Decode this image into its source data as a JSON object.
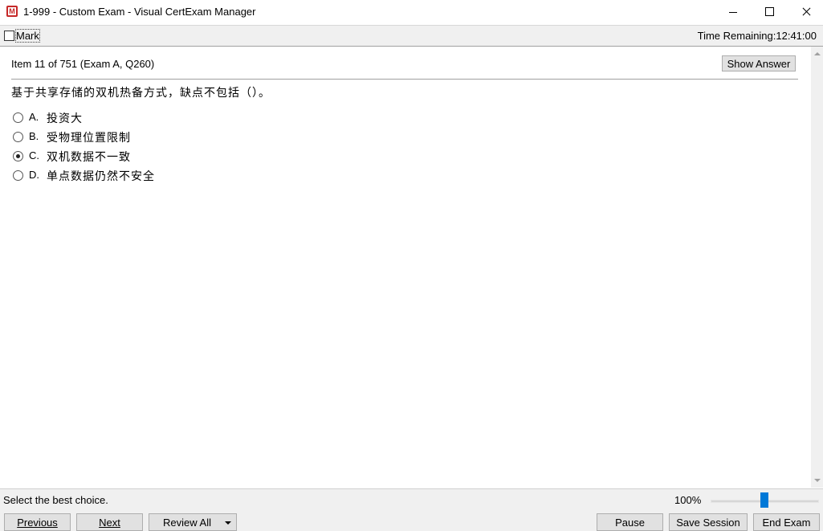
{
  "window": {
    "title": "1-999 - Custom Exam - Visual CertExam Manager",
    "icon": "M"
  },
  "markbar": {
    "mark_label": "Mark",
    "time_remaining": "Time Remaining:12:41:00"
  },
  "question": {
    "item_info": "Item 11 of 751  (Exam A, Q260)",
    "show_answer_label": "Show Answer",
    "text": "基于共享存储的双机热备方式，缺点不包括（）。",
    "options": [
      {
        "letter": "A.",
        "text": "投资大",
        "selected": false
      },
      {
        "letter": "B.",
        "text": "受物理位置限制",
        "selected": false
      },
      {
        "letter": "C.",
        "text": "双机数据不一致",
        "selected": true
      },
      {
        "letter": "D.",
        "text": "单点数据仍然不安全",
        "selected": false
      }
    ]
  },
  "statusbar": {
    "hint": "Select the best choice.",
    "zoom": "100%"
  },
  "bottombar": {
    "previous": "Previous",
    "next": "Next",
    "review_all": "Review All",
    "pause": "Pause",
    "save_session": "Save Session",
    "end_exam": "End Exam"
  }
}
